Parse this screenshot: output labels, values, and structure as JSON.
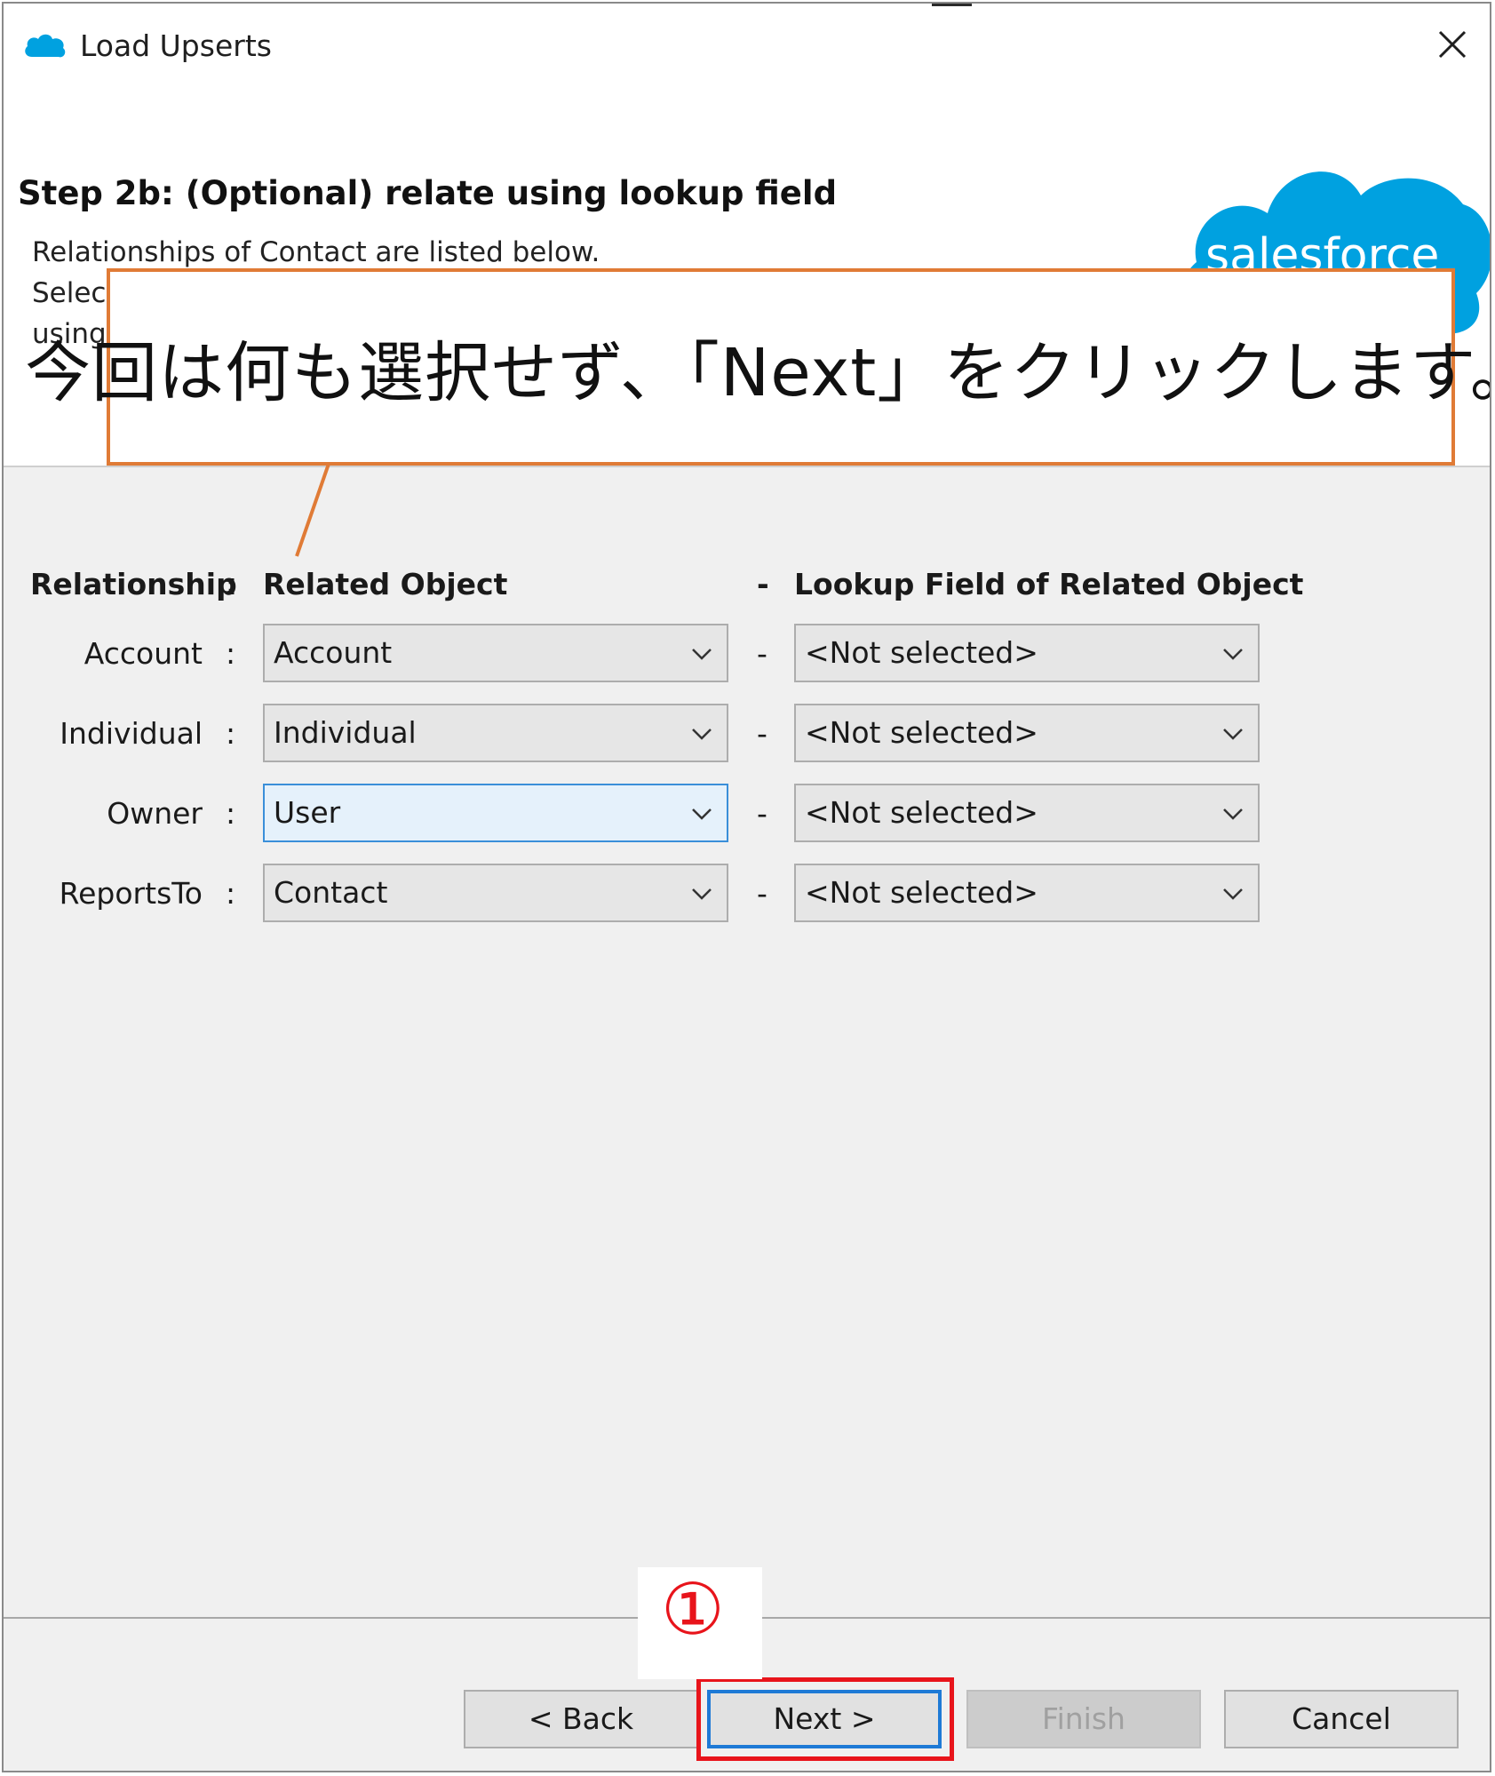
{
  "window": {
    "title": "Load Upserts"
  },
  "header": {
    "step_title": "Step 2b: (Optional) relate using lookup field",
    "description_line1": "Relationships of Contact are listed below.",
    "description_line2": "Selec",
    "description_line3": "using",
    "logo_text": "salesforce"
  },
  "annotation": {
    "callout_text": "今回は何も選択せず、「Next」をクリックします。",
    "marker": "①"
  },
  "table": {
    "headers": {
      "relationship": "Relationship",
      "colon": ":",
      "related_object": "Related Object",
      "dash": "-",
      "lookup_field": "Lookup Field of Related Object"
    },
    "rows": [
      {
        "relationship": "Account",
        "related_object": "Account",
        "lookup_field": "<Not selected>"
      },
      {
        "relationship": "Individual",
        "related_object": "Individual",
        "lookup_field": "<Not selected>"
      },
      {
        "relationship": "Owner",
        "related_object": "User",
        "lookup_field": "<Not selected>"
      },
      {
        "relationship": "ReportsTo",
        "related_object": "Contact",
        "lookup_field": "<Not selected>"
      }
    ]
  },
  "buttons": {
    "back": "< Back",
    "next": "Next >",
    "finish": "Finish",
    "cancel": "Cancel"
  },
  "colors": {
    "callout_border": "#e07b36",
    "highlight": "#e8141b",
    "focus": "#3a8fd9",
    "salesforce_blue": "#00a1e0"
  }
}
